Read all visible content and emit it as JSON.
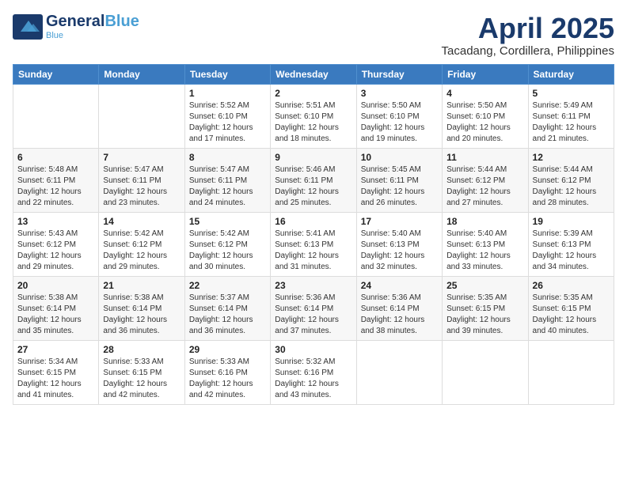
{
  "header": {
    "logo": {
      "line1": "General",
      "line1_accent": "Blue",
      "tagline": ""
    },
    "title": "April 2025",
    "subtitle": "Tacadang, Cordillera, Philippines"
  },
  "weekdays": [
    "Sunday",
    "Monday",
    "Tuesday",
    "Wednesday",
    "Thursday",
    "Friday",
    "Saturday"
  ],
  "weeks": [
    [
      {
        "day": "",
        "sunrise": "",
        "sunset": "",
        "daylight": ""
      },
      {
        "day": "",
        "sunrise": "",
        "sunset": "",
        "daylight": ""
      },
      {
        "day": "1",
        "sunrise": "Sunrise: 5:52 AM",
        "sunset": "Sunset: 6:10 PM",
        "daylight": "Daylight: 12 hours and 17 minutes."
      },
      {
        "day": "2",
        "sunrise": "Sunrise: 5:51 AM",
        "sunset": "Sunset: 6:10 PM",
        "daylight": "Daylight: 12 hours and 18 minutes."
      },
      {
        "day": "3",
        "sunrise": "Sunrise: 5:50 AM",
        "sunset": "Sunset: 6:10 PM",
        "daylight": "Daylight: 12 hours and 19 minutes."
      },
      {
        "day": "4",
        "sunrise": "Sunrise: 5:50 AM",
        "sunset": "Sunset: 6:10 PM",
        "daylight": "Daylight: 12 hours and 20 minutes."
      },
      {
        "day": "5",
        "sunrise": "Sunrise: 5:49 AM",
        "sunset": "Sunset: 6:11 PM",
        "daylight": "Daylight: 12 hours and 21 minutes."
      }
    ],
    [
      {
        "day": "6",
        "sunrise": "Sunrise: 5:48 AM",
        "sunset": "Sunset: 6:11 PM",
        "daylight": "Daylight: 12 hours and 22 minutes."
      },
      {
        "day": "7",
        "sunrise": "Sunrise: 5:47 AM",
        "sunset": "Sunset: 6:11 PM",
        "daylight": "Daylight: 12 hours and 23 minutes."
      },
      {
        "day": "8",
        "sunrise": "Sunrise: 5:47 AM",
        "sunset": "Sunset: 6:11 PM",
        "daylight": "Daylight: 12 hours and 24 minutes."
      },
      {
        "day": "9",
        "sunrise": "Sunrise: 5:46 AM",
        "sunset": "Sunset: 6:11 PM",
        "daylight": "Daylight: 12 hours and 25 minutes."
      },
      {
        "day": "10",
        "sunrise": "Sunrise: 5:45 AM",
        "sunset": "Sunset: 6:11 PM",
        "daylight": "Daylight: 12 hours and 26 minutes."
      },
      {
        "day": "11",
        "sunrise": "Sunrise: 5:44 AM",
        "sunset": "Sunset: 6:12 PM",
        "daylight": "Daylight: 12 hours and 27 minutes."
      },
      {
        "day": "12",
        "sunrise": "Sunrise: 5:44 AM",
        "sunset": "Sunset: 6:12 PM",
        "daylight": "Daylight: 12 hours and 28 minutes."
      }
    ],
    [
      {
        "day": "13",
        "sunrise": "Sunrise: 5:43 AM",
        "sunset": "Sunset: 6:12 PM",
        "daylight": "Daylight: 12 hours and 29 minutes."
      },
      {
        "day": "14",
        "sunrise": "Sunrise: 5:42 AM",
        "sunset": "Sunset: 6:12 PM",
        "daylight": "Daylight: 12 hours and 29 minutes."
      },
      {
        "day": "15",
        "sunrise": "Sunrise: 5:42 AM",
        "sunset": "Sunset: 6:12 PM",
        "daylight": "Daylight: 12 hours and 30 minutes."
      },
      {
        "day": "16",
        "sunrise": "Sunrise: 5:41 AM",
        "sunset": "Sunset: 6:13 PM",
        "daylight": "Daylight: 12 hours and 31 minutes."
      },
      {
        "day": "17",
        "sunrise": "Sunrise: 5:40 AM",
        "sunset": "Sunset: 6:13 PM",
        "daylight": "Daylight: 12 hours and 32 minutes."
      },
      {
        "day": "18",
        "sunrise": "Sunrise: 5:40 AM",
        "sunset": "Sunset: 6:13 PM",
        "daylight": "Daylight: 12 hours and 33 minutes."
      },
      {
        "day": "19",
        "sunrise": "Sunrise: 5:39 AM",
        "sunset": "Sunset: 6:13 PM",
        "daylight": "Daylight: 12 hours and 34 minutes."
      }
    ],
    [
      {
        "day": "20",
        "sunrise": "Sunrise: 5:38 AM",
        "sunset": "Sunset: 6:14 PM",
        "daylight": "Daylight: 12 hours and 35 minutes."
      },
      {
        "day": "21",
        "sunrise": "Sunrise: 5:38 AM",
        "sunset": "Sunset: 6:14 PM",
        "daylight": "Daylight: 12 hours and 36 minutes."
      },
      {
        "day": "22",
        "sunrise": "Sunrise: 5:37 AM",
        "sunset": "Sunset: 6:14 PM",
        "daylight": "Daylight: 12 hours and 36 minutes."
      },
      {
        "day": "23",
        "sunrise": "Sunrise: 5:36 AM",
        "sunset": "Sunset: 6:14 PM",
        "daylight": "Daylight: 12 hours and 37 minutes."
      },
      {
        "day": "24",
        "sunrise": "Sunrise: 5:36 AM",
        "sunset": "Sunset: 6:14 PM",
        "daylight": "Daylight: 12 hours and 38 minutes."
      },
      {
        "day": "25",
        "sunrise": "Sunrise: 5:35 AM",
        "sunset": "Sunset: 6:15 PM",
        "daylight": "Daylight: 12 hours and 39 minutes."
      },
      {
        "day": "26",
        "sunrise": "Sunrise: 5:35 AM",
        "sunset": "Sunset: 6:15 PM",
        "daylight": "Daylight: 12 hours and 40 minutes."
      }
    ],
    [
      {
        "day": "27",
        "sunrise": "Sunrise: 5:34 AM",
        "sunset": "Sunset: 6:15 PM",
        "daylight": "Daylight: 12 hours and 41 minutes."
      },
      {
        "day": "28",
        "sunrise": "Sunrise: 5:33 AM",
        "sunset": "Sunset: 6:15 PM",
        "daylight": "Daylight: 12 hours and 42 minutes."
      },
      {
        "day": "29",
        "sunrise": "Sunrise: 5:33 AM",
        "sunset": "Sunset: 6:16 PM",
        "daylight": "Daylight: 12 hours and 42 minutes."
      },
      {
        "day": "30",
        "sunrise": "Sunrise: 5:32 AM",
        "sunset": "Sunset: 6:16 PM",
        "daylight": "Daylight: 12 hours and 43 minutes."
      },
      {
        "day": "",
        "sunrise": "",
        "sunset": "",
        "daylight": ""
      },
      {
        "day": "",
        "sunrise": "",
        "sunset": "",
        "daylight": ""
      },
      {
        "day": "",
        "sunrise": "",
        "sunset": "",
        "daylight": ""
      }
    ]
  ]
}
